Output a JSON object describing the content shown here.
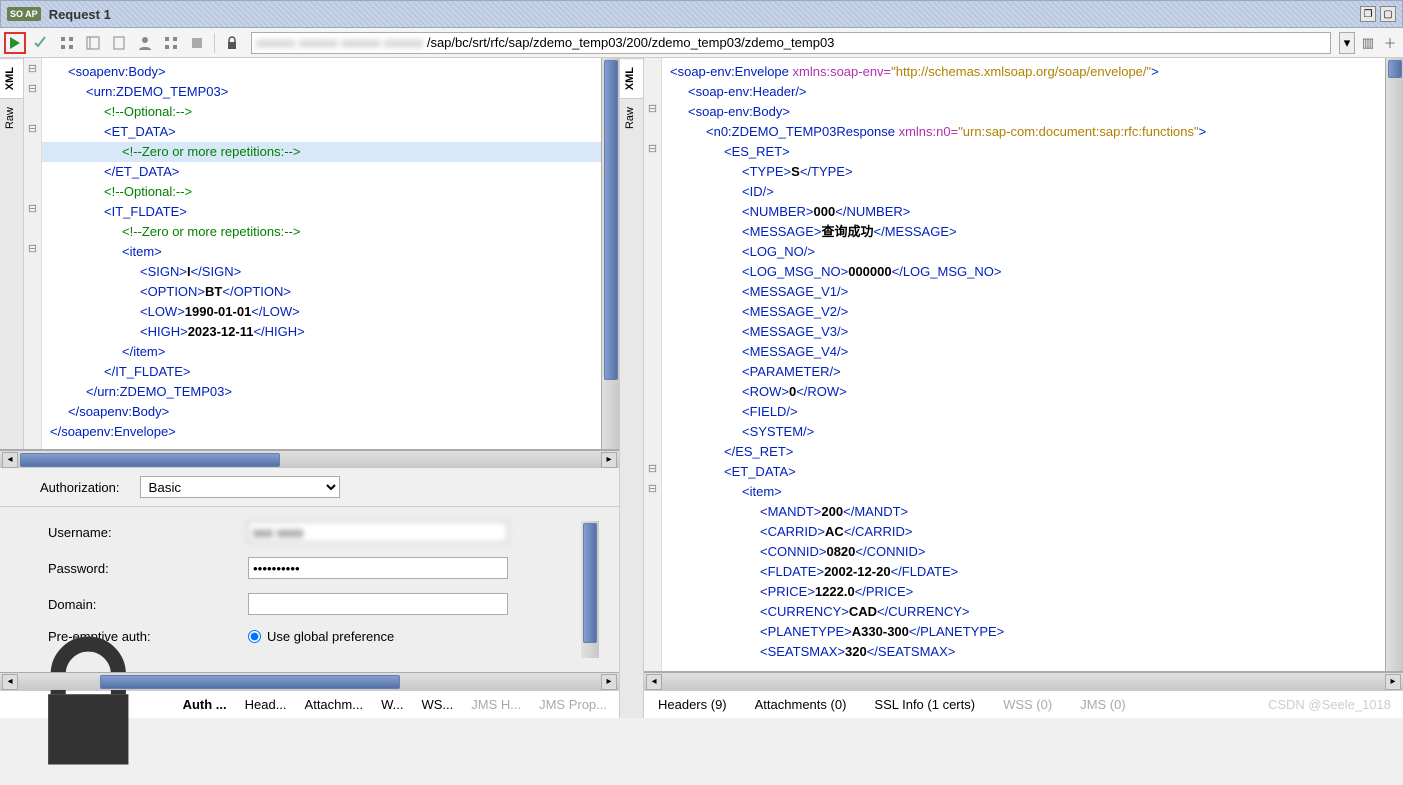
{
  "window": {
    "badge": "SO AP",
    "title": "Request 1"
  },
  "toolbar": {
    "url_prefix_blur": "xxxxxx xxxxxx xxxxxx xxxxxx",
    "url": "/sap/bc/srt/rfc/sap/zdemo_temp03/200/zdemo_temp03/zdemo_temp03"
  },
  "vtabs": {
    "xml": "XML",
    "raw": "Raw"
  },
  "request_xml": [
    {
      "i": 1,
      "t": "tag",
      "v": "<soapenv:Body>"
    },
    {
      "i": 2,
      "t": "tag",
      "v": "<urn:ZDEMO_TEMP03>"
    },
    {
      "i": 3,
      "t": "cmt",
      "v": "<!--Optional:-->"
    },
    {
      "i": 3,
      "t": "tag",
      "v": "<ET_DATA>"
    },
    {
      "i": 4,
      "t": "cmt",
      "v": "<!--Zero or more repetitions:-->",
      "hl": true
    },
    {
      "i": 3,
      "t": "tag",
      "v": "</ET_DATA>"
    },
    {
      "i": 3,
      "t": "cmt",
      "v": "<!--Optional:-->"
    },
    {
      "i": 3,
      "t": "tag",
      "v": "<IT_FLDATE>"
    },
    {
      "i": 4,
      "t": "cmt",
      "v": "<!--Zero or more repetitions:-->"
    },
    {
      "i": 4,
      "t": "tag",
      "v": "<item>"
    },
    {
      "i": 5,
      "t": "pair",
      "open": "<SIGN>",
      "val": "I",
      "close": "</SIGN>"
    },
    {
      "i": 5,
      "t": "pair",
      "open": "<OPTION>",
      "val": "BT",
      "close": "</OPTION>"
    },
    {
      "i": 5,
      "t": "pair",
      "open": "<LOW>",
      "val": "1990-01-01",
      "close": "</LOW>"
    },
    {
      "i": 5,
      "t": "pair",
      "open": "<HIGH>",
      "val": "2023-12-11",
      "close": "</HIGH>"
    },
    {
      "i": 4,
      "t": "tag",
      "v": "</item>"
    },
    {
      "i": 3,
      "t": "tag",
      "v": "</IT_FLDATE>"
    },
    {
      "i": 2,
      "t": "tag",
      "v": "</urn:ZDEMO_TEMP03>"
    },
    {
      "i": 1,
      "t": "tag",
      "v": "</soapenv:Body>"
    },
    {
      "i": 0,
      "t": "tag",
      "v": "</soapenv:Envelope>"
    }
  ],
  "response_xml": [
    {
      "i": 0,
      "t": "envelope",
      "open": "<soap-env:Envelope",
      "attr": " xmlns:soap-env=",
      "val": "\"http://schemas.xmlsoap.org/soap/envelope/\"",
      "close": ">"
    },
    {
      "i": 1,
      "t": "tag",
      "v": "<soap-env:Header/>"
    },
    {
      "i": 1,
      "t": "tag",
      "v": "<soap-env:Body>"
    },
    {
      "i": 2,
      "t": "envelope",
      "open": "<n0:ZDEMO_TEMP03Response",
      "attr": " xmlns:n0=",
      "val": "\"urn:sap-com:document:sap:rfc:functions\"",
      "close": ">"
    },
    {
      "i": 3,
      "t": "tag",
      "v": "<ES_RET>"
    },
    {
      "i": 4,
      "t": "pair",
      "open": "<TYPE>",
      "val": "S",
      "close": "</TYPE>"
    },
    {
      "i": 4,
      "t": "tag",
      "v": "<ID/>"
    },
    {
      "i": 4,
      "t": "pair",
      "open": "<NUMBER>",
      "val": "000",
      "close": "</NUMBER>"
    },
    {
      "i": 4,
      "t": "pair",
      "open": "<MESSAGE>",
      "val": "查询成功",
      "close": "</MESSAGE>"
    },
    {
      "i": 4,
      "t": "tag",
      "v": "<LOG_NO/>"
    },
    {
      "i": 4,
      "t": "pair",
      "open": "<LOG_MSG_NO>",
      "val": "000000",
      "close": "</LOG_MSG_NO>"
    },
    {
      "i": 4,
      "t": "tag",
      "v": "<MESSAGE_V1/>"
    },
    {
      "i": 4,
      "t": "tag",
      "v": "<MESSAGE_V2/>"
    },
    {
      "i": 4,
      "t": "tag",
      "v": "<MESSAGE_V3/>"
    },
    {
      "i": 4,
      "t": "tag",
      "v": "<MESSAGE_V4/>"
    },
    {
      "i": 4,
      "t": "tag",
      "v": "<PARAMETER/>"
    },
    {
      "i": 4,
      "t": "pair",
      "open": "<ROW>",
      "val": "0",
      "close": "</ROW>"
    },
    {
      "i": 4,
      "t": "tag",
      "v": "<FIELD/>"
    },
    {
      "i": 4,
      "t": "tag",
      "v": "<SYSTEM/>"
    },
    {
      "i": 3,
      "t": "tag",
      "v": "</ES_RET>"
    },
    {
      "i": 3,
      "t": "tag",
      "v": "<ET_DATA>"
    },
    {
      "i": 4,
      "t": "tag",
      "v": "<item>"
    },
    {
      "i": 5,
      "t": "pair",
      "open": "<MANDT>",
      "val": "200",
      "close": "</MANDT>"
    },
    {
      "i": 5,
      "t": "pair",
      "open": "<CARRID>",
      "val": "AC",
      "close": "</CARRID>"
    },
    {
      "i": 5,
      "t": "pair",
      "open": "<CONNID>",
      "val": "0820",
      "close": "</CONNID>"
    },
    {
      "i": 5,
      "t": "pair",
      "open": "<FLDATE>",
      "val": "2002-12-20",
      "close": "</FLDATE>"
    },
    {
      "i": 5,
      "t": "pair",
      "open": "<PRICE>",
      "val": "1222.0",
      "close": "</PRICE>"
    },
    {
      "i": 5,
      "t": "pair",
      "open": "<CURRENCY>",
      "val": "CAD",
      "close": "</CURRENCY>"
    },
    {
      "i": 5,
      "t": "pair",
      "open": "<PLANETYPE>",
      "val": "A330-300",
      "close": "</PLANETYPE>"
    },
    {
      "i": 5,
      "t": "pair",
      "open": "<SEATSMAX>",
      "val": "320",
      "close": "</SEATSMAX>"
    }
  ],
  "auth": {
    "label": "Authorization:",
    "type": "Basic",
    "username_label": "Username:",
    "username_value": "xxx xxxx",
    "password_label": "Password:",
    "password_value": "••••••••••",
    "domain_label": "Domain:",
    "domain_value": "",
    "preemptive_label": "Pre-emptive auth:",
    "preemptive_option": "Use global preference"
  },
  "left_tabs": {
    "auth": "Auth ...",
    "headers": "Head...",
    "attachments": "Attachm...",
    "ws": "W...",
    "wsrm": "WS...",
    "jmsh": "JMS H...",
    "jmsp": "JMS Prop..."
  },
  "right_tabs": {
    "headers": "Headers (9)",
    "attachments": "Attachments (0)",
    "sslinfo": "SSL Info (1 certs)",
    "wss": "WSS (0)",
    "jms": "JMS (0)"
  },
  "watermark": "CSDN @Seele_1018"
}
